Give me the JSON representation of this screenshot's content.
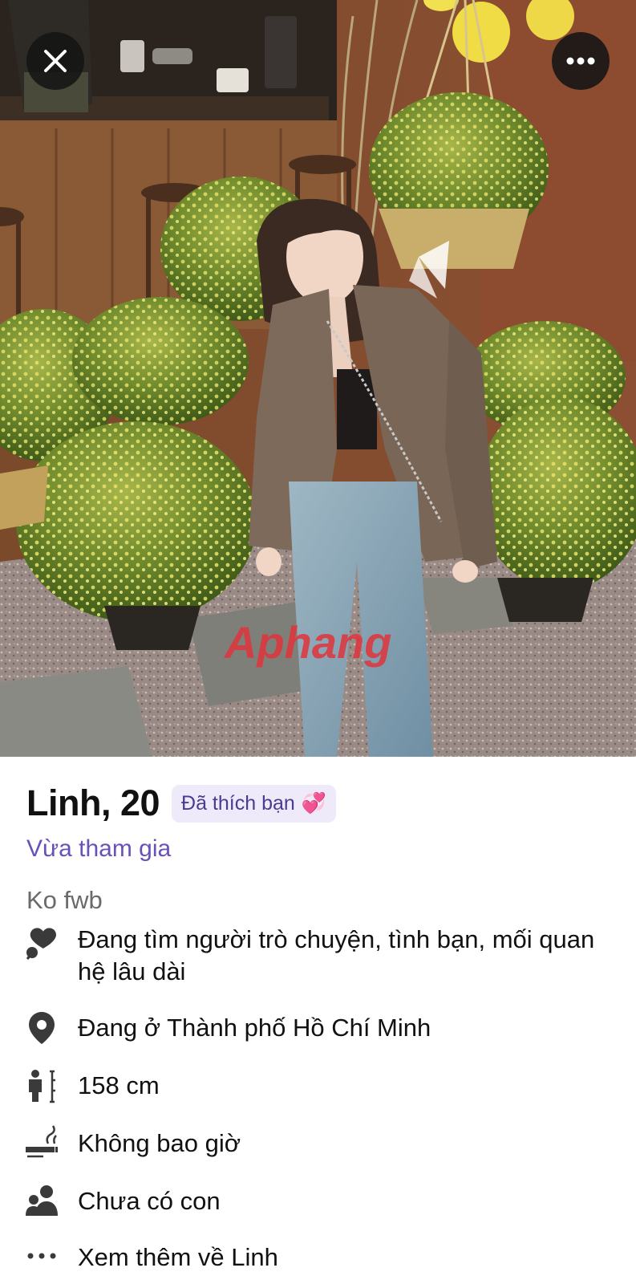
{
  "header": {
    "close_icon": "close-icon",
    "more_icon": "more-horizontal-icon"
  },
  "photo": {
    "watermark": "Aphang"
  },
  "profile": {
    "name_age": "Linh, 20",
    "liked_badge": "Đã thích bạn",
    "liked_badge_emoji": "💞",
    "joined_status": "Vừa tham gia",
    "bio": "Ko fwb"
  },
  "details": [
    {
      "icon": "heart-search-icon",
      "line1": "Đang tìm người trò chuyện, tình bạn, mối quan",
      "line2": "hệ lâu dài"
    },
    {
      "icon": "location-pin-icon",
      "line1": "Đang ở Thành phố Hồ Chí Minh"
    },
    {
      "icon": "height-icon",
      "line1": "158 cm"
    },
    {
      "icon": "smoking-icon",
      "line1": "Không bao giờ"
    },
    {
      "icon": "people-icon",
      "line1": "Chưa có con"
    },
    {
      "icon": "more-dots-icon",
      "line1": "Xem thêm về Linh"
    }
  ],
  "colors": {
    "accent_purple": "#6951b8",
    "badge_bg": "#eeeaf9",
    "badge_text": "#4b3c8f",
    "secondary_text": "#6a6a6a",
    "primary_text": "#111111"
  }
}
